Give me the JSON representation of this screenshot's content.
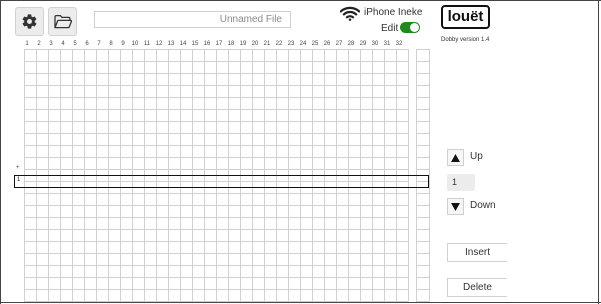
{
  "toolbar": {
    "settings_icon": "gear-icon",
    "open_icon": "folder-open-icon",
    "filename_placeholder": "Unnamed File"
  },
  "connection": {
    "icon": "wifi-icon",
    "device_name": "iPhone Ineke",
    "edit_label": "Edit",
    "edit_enabled": true,
    "toggle_color": "#1e8a1e"
  },
  "brand": {
    "logo_text": "louët",
    "version": "Dobby version 1.4"
  },
  "grid": {
    "columns": [
      "1",
      "2",
      "3",
      "4",
      "5",
      "6",
      "7",
      "8",
      "9",
      "10",
      "11",
      "12",
      "13",
      "14",
      "15",
      "16",
      "17",
      "18",
      "19",
      "20",
      "21",
      "22",
      "23",
      "24",
      "25",
      "26",
      "27",
      "28",
      "29",
      "30",
      "31",
      "32"
    ],
    "current_row_label": "1",
    "add_row_marker": "+"
  },
  "controls": {
    "up_label": "Up",
    "down_label": "Down",
    "row_value": "1",
    "insert_label": "Insert",
    "delete_label": "Delete"
  }
}
